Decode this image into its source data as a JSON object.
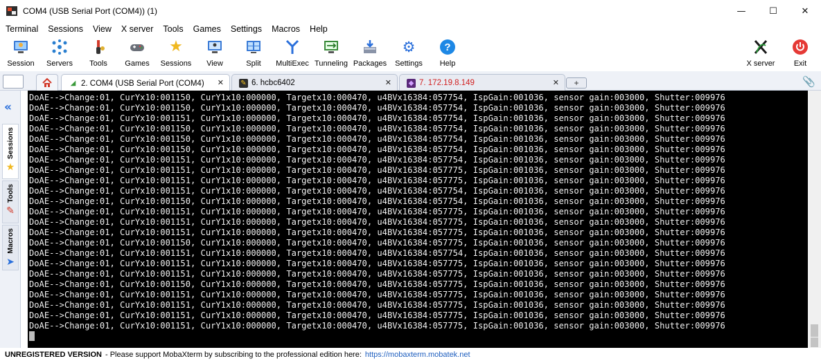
{
  "window": {
    "title": "COM4  (USB Serial Port (COM4)) (1)",
    "minimize_glyph": "—",
    "maximize_glyph": "☐",
    "close_glyph": "✕"
  },
  "menu": [
    "Terminal",
    "Sessions",
    "View",
    "X server",
    "Tools",
    "Games",
    "Settings",
    "Macros",
    "Help"
  ],
  "toolbar": {
    "session": "Session",
    "servers": "Servers",
    "tools": "Tools",
    "games": "Games",
    "sessions": "Sessions",
    "view": "View",
    "split": "Split",
    "multiexec": "MultiExec",
    "tunneling": "Tunneling",
    "packages": "Packages",
    "settings": "Settings",
    "help": "Help",
    "xserver": "X server",
    "exit": "Exit"
  },
  "tabs": [
    {
      "label": "2. COM4  (USB Serial Port (COM4)",
      "active": true
    },
    {
      "label": "6. hcbc6402",
      "active": false
    },
    {
      "label": "7. 172.19.8.149",
      "active": false,
      "color": "#d12020"
    }
  ],
  "tab_close_glyph": "✕",
  "side": {
    "sessions": "Sessions",
    "tools": "Tools",
    "macros": "Macros"
  },
  "colors": {
    "accent": "#2a6fdb",
    "terminal_bg": "#000000",
    "terminal_fg": "#f2f2f2",
    "ssh_tab_text": "#d12020"
  },
  "terminal": {
    "lines": [
      "DoAE-->Change:01, CurYx10:001150, CurY1x10:000000, Targetx10:000470, u4BVx16384:057754, IspGain:001036, sensor gain:003000, Shutter:009976",
      "DoAE-->Change:01, CurYx10:001150, CurY1x10:000000, Targetx10:000470, u4BVx16384:057754, IspGain:001036, sensor gain:003000, Shutter:009976",
      "DoAE-->Change:01, CurYx10:001151, CurY1x10:000000, Targetx10:000470, u4BVx16384:057754, IspGain:001036, sensor gain:003000, Shutter:009976",
      "DoAE-->Change:01, CurYx10:001150, CurY1x10:000000, Targetx10:000470, u4BVx16384:057754, IspGain:001036, sensor gain:003000, Shutter:009976",
      "DoAE-->Change:01, CurYx10:001150, CurY1x10:000000, Targetx10:000470, u4BVx16384:057754, IspGain:001036, sensor gain:003000, Shutter:009976",
      "DoAE-->Change:01, CurYx10:001150, CurY1x10:000000, Targetx10:000470, u4BVx16384:057754, IspGain:001036, sensor gain:003000, Shutter:009976",
      "DoAE-->Change:01, CurYx10:001151, CurY1x10:000000, Targetx10:000470, u4BVx16384:057754, IspGain:001036, sensor gain:003000, Shutter:009976",
      "DoAE-->Change:01, CurYx10:001151, CurY1x10:000000, Targetx10:000470, u4BVx16384:057775, IspGain:001036, sensor gain:003000, Shutter:009976",
      "DoAE-->Change:01, CurYx10:001151, CurY1x10:000000, Targetx10:000470, u4BVx16384:057775, IspGain:001036, sensor gain:003000, Shutter:009976",
      "DoAE-->Change:01, CurYx10:001151, CurY1x10:000000, Targetx10:000470, u4BVx16384:057754, IspGain:001036, sensor gain:003000, Shutter:009976",
      "DoAE-->Change:01, CurYx10:001150, CurY1x10:000000, Targetx10:000470, u4BVx16384:057754, IspGain:001036, sensor gain:003000, Shutter:009976",
      "DoAE-->Change:01, CurYx10:001151, CurY1x10:000000, Targetx10:000470, u4BVx16384:057775, IspGain:001036, sensor gain:003000, Shutter:009976",
      "DoAE-->Change:01, CurYx10:001151, CurY1x10:000000, Targetx10:000470, u4BVx16384:057775, IspGain:001036, sensor gain:003000, Shutter:009976",
      "DoAE-->Change:01, CurYx10:001151, CurY1x10:000000, Targetx10:000470, u4BVx16384:057775, IspGain:001036, sensor gain:003000, Shutter:009976",
      "DoAE-->Change:01, CurYx10:001150, CurY1x10:000000, Targetx10:000470, u4BVx16384:057775, IspGain:001036, sensor gain:003000, Shutter:009976",
      "DoAE-->Change:01, CurYx10:001151, CurY1x10:000000, Targetx10:000470, u4BVx16384:057754, IspGain:001036, sensor gain:003000, Shutter:009976",
      "DoAE-->Change:01, CurYx10:001151, CurY1x10:000000, Targetx10:000470, u4BVx16384:057775, IspGain:001036, sensor gain:003000, Shutter:009976",
      "DoAE-->Change:01, CurYx10:001151, CurY1x10:000000, Targetx10:000470, u4BVx16384:057775, IspGain:001036, sensor gain:003000, Shutter:009976",
      "DoAE-->Change:01, CurYx10:001150, CurY1x10:000000, Targetx10:000470, u4BVx16384:057775, IspGain:001036, sensor gain:003000, Shutter:009976",
      "DoAE-->Change:01, CurYx10:001151, CurY1x10:000000, Targetx10:000470, u4BVx16384:057775, IspGain:001036, sensor gain:003000, Shutter:009976",
      "DoAE-->Change:01, CurYx10:001151, CurY1x10:000000, Targetx10:000470, u4BVx16384:057775, IspGain:001036, sensor gain:003000, Shutter:009976",
      "DoAE-->Change:01, CurYx10:001151, CurY1x10:000000, Targetx10:000470, u4BVx16384:057775, IspGain:001036, sensor gain:003000, Shutter:009976",
      "DoAE-->Change:01, CurYx10:001151, CurY1x10:000000, Targetx10:000470, u4BVx16384:057775, IspGain:001036, sensor gain:003000, Shutter:009976"
    ]
  },
  "status": {
    "label": "UNREGISTERED VERSION",
    "message": "-  Please support MobaXterm by subscribing to the professional edition here:",
    "link": "https://mobaxterm.mobatek.net"
  }
}
